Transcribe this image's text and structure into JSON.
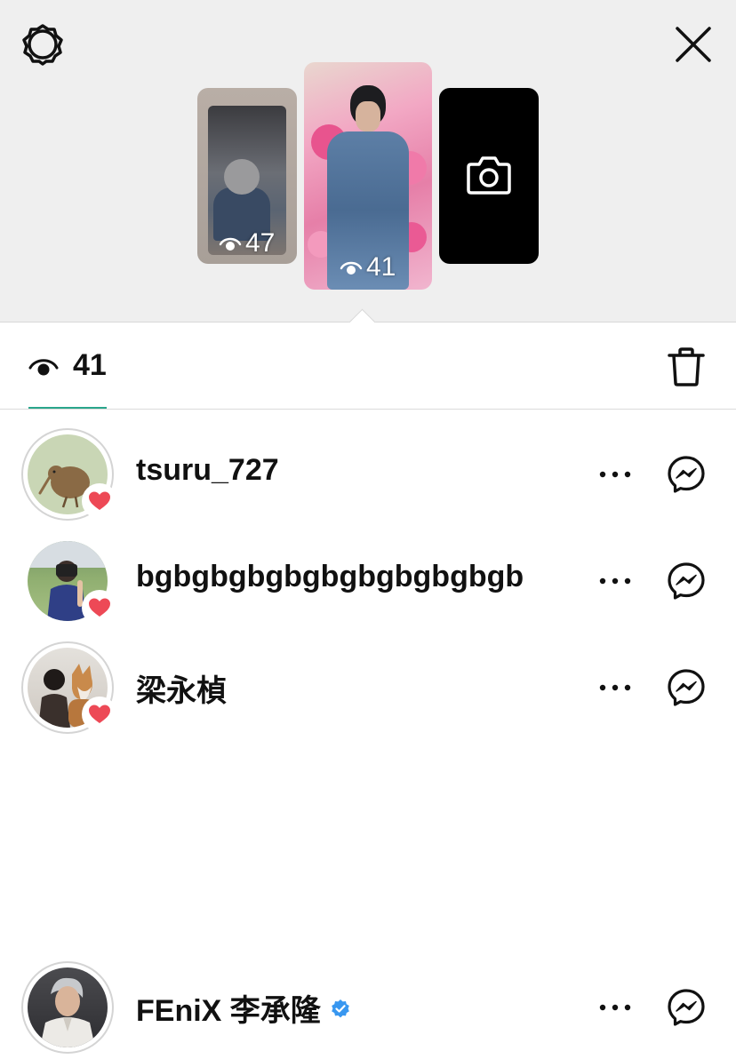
{
  "story_tray": {
    "stories": [
      {
        "views": "47"
      },
      {
        "views": "41"
      },
      {
        "type": "camera",
        "icon": "camera-icon"
      }
    ]
  },
  "views_header": {
    "count": "41",
    "icon": "eye-icon",
    "delete_icon": "trash-icon",
    "accent_color": "#2aa68c"
  },
  "viewers": [
    {
      "username": "tsuru_727",
      "liked": true,
      "verified": false
    },
    {
      "username": "bgbgbgbgbgbgbgbgbgbgb",
      "liked": true,
      "verified": false
    },
    {
      "username": "梁永楨",
      "liked": true,
      "verified": false
    },
    {
      "username": "FEniX 李承隆",
      "liked": false,
      "verified": true
    }
  ],
  "colors": {
    "heart": "#ed4956",
    "verified": "#3897f0",
    "tray_background": "#efefef"
  }
}
